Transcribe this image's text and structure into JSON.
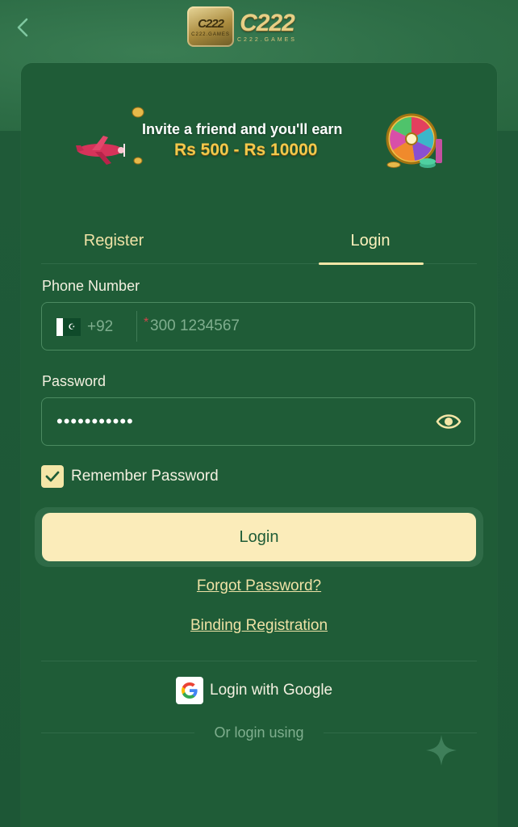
{
  "header": {
    "back_icon": "chevron-left-icon",
    "logo_text": "C222",
    "logo_sub": "C222.GAMES"
  },
  "banner": {
    "line1": "Invite a friend and you'll earn",
    "line2": "Rs 500 - Rs 10000"
  },
  "tabs": [
    {
      "label": "Register",
      "active": false
    },
    {
      "label": "Login",
      "active": true
    }
  ],
  "form": {
    "phone_label": "Phone Number",
    "country_code": "+92",
    "phone_placeholder": "300 1234567",
    "phone_required_mark": "*",
    "password_label": "Password",
    "password_value": "•••••••••••",
    "remember_label": "Remember Password",
    "remember_checked": true,
    "submit_label": "Login"
  },
  "links": {
    "forgot": "Forgot Password?",
    "binding": "Binding Registration"
  },
  "social": {
    "google_label": "Login with Google",
    "or_text": "Or login using"
  },
  "colors": {
    "background": "#1f5c37",
    "accent": "#f4e6a7",
    "button": "#fbecba"
  }
}
